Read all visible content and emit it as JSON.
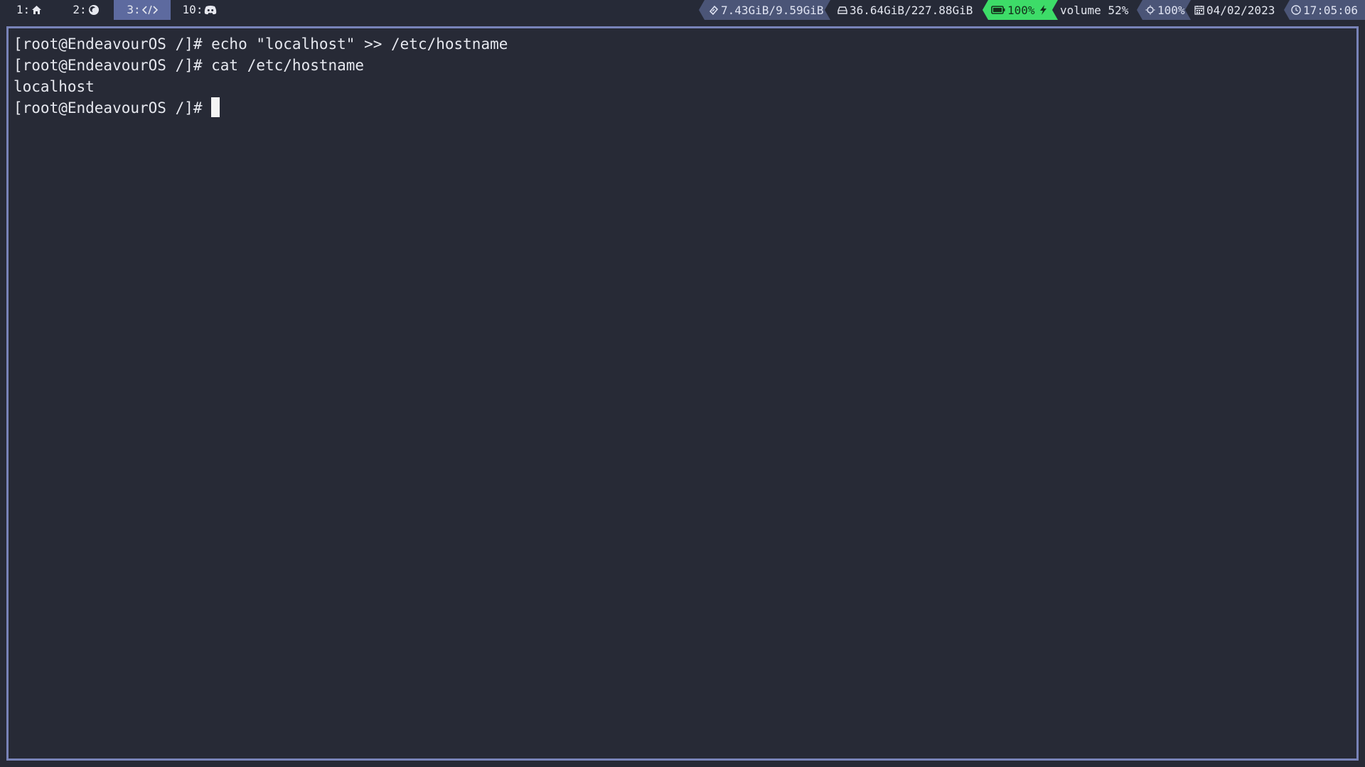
{
  "taskbar": {
    "workspaces": [
      {
        "label": "1:",
        "icon": "home-icon",
        "active": false
      },
      {
        "label": "2:",
        "icon": "firefox-icon",
        "active": false
      },
      {
        "label": "3:",
        "icon": "code-icon",
        "active": true
      },
      {
        "label": "10:",
        "icon": "discord-icon",
        "active": false
      }
    ],
    "memory": "7.43GiB/9.59GiB",
    "disk": "36.64GiB/227.88GiB",
    "battery": "100%",
    "volume": "volume 52%",
    "brightness": "100%",
    "date": "04/02/2023",
    "time": "17:05:06",
    "colors": {
      "bar_bg": "#262a37",
      "pill_bg": "#4b5577",
      "active_ws": "#5d6a9f",
      "battery": "#3ddc68"
    }
  },
  "terminal": {
    "lines": [
      "[root@EndeavourOS /]# echo \"localhost\" >> /etc/hostname",
      "[root@EndeavourOS /]# cat /etc/hostname",
      "localhost",
      "[root@EndeavourOS /]# "
    ],
    "colors": {
      "bg": "#272a36",
      "border": "#7883b8",
      "fg": "#e6e8ef"
    }
  }
}
